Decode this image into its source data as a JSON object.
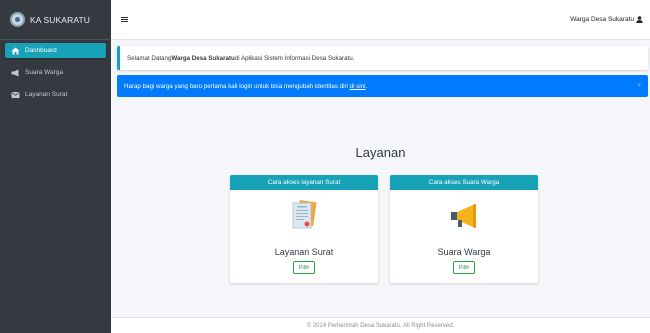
{
  "brand": {
    "name": "KA SUKARATU",
    "logo_icon": "village-seal-icon"
  },
  "sidebar": {
    "items": [
      {
        "label": "Dashboard",
        "icon": "home-icon",
        "active": true
      },
      {
        "label": "Suara Warga",
        "icon": "megaphone-icon",
        "active": false
      },
      {
        "label": "Layanan Surat",
        "icon": "envelope-icon",
        "active": false
      }
    ]
  },
  "topbar": {
    "user_name": "Warga Desa Sukaratu",
    "user_icon": "user-icon"
  },
  "welcome": {
    "prefix": "Selamat Datang ",
    "name": "Warga Desa Sukaratu",
    "suffix": " di Aplikasi Sistem Informasi Desa Sukaratu."
  },
  "alert": {
    "text": "Harap bagi warga yang baru pertama kali login untuk bisa mengubah identitas diri ",
    "link": "di sini",
    "end": ".",
    "close": "×"
  },
  "services": {
    "title": "Layanan",
    "cards": [
      {
        "header": "Cara akses layanan Surat",
        "label": "Layanan Surat",
        "button": "Pilih",
        "icon": "document-icon"
      },
      {
        "header": "Cara akses Suara Warga",
        "label": "Suara Warga",
        "button": "Pilih",
        "icon": "megaphone-icon"
      }
    ]
  },
  "footer": {
    "text": "© 2024 Pemerintah Desa Sukaratu. All Right Reserved."
  },
  "colors": {
    "accent": "#17a2b8",
    "alert": "#007bff",
    "sidebar": "#343a40",
    "success": "#28a745"
  }
}
